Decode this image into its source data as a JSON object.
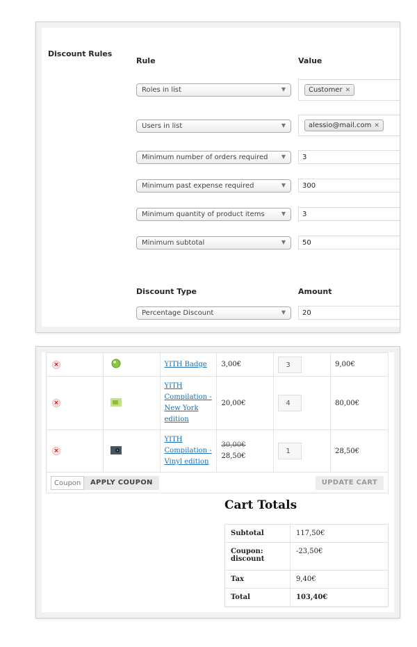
{
  "discount_rules": {
    "section_title": "Discount Rules",
    "rule_header": "Rule",
    "value_header": "Value",
    "rules": [
      {
        "rule": "Roles in list",
        "tag": "Customer"
      },
      {
        "rule": "Users in list",
        "tag": "alessio@mail.com"
      },
      {
        "rule": "Minimum number of orders required",
        "value": "3"
      },
      {
        "rule": "Minimum past expense required",
        "value": "300"
      },
      {
        "rule": "Minimum quantity of product items",
        "value": "3"
      },
      {
        "rule": "Minimum subtotal",
        "value": "50"
      }
    ],
    "type_header": "Discount Type",
    "amount_header": "Amount",
    "discount_type": "Percentage Discount",
    "amount": "20"
  },
  "cart": {
    "items": [
      {
        "name": "YITH Badge",
        "price": "3,00€",
        "qty": "3",
        "total": "9,00€"
      },
      {
        "name": "YITH Compilation - New York edition",
        "price": "20,00€",
        "qty": "4",
        "total": "80,00€"
      },
      {
        "name": "YITH Compilation - Vinyl edition",
        "old_price": "30,00€",
        "price": "28,50€",
        "qty": "1",
        "total": "28,50€"
      }
    ],
    "coupon_placeholder": "Coupon",
    "apply_coupon_label": "APPLY COUPON",
    "update_cart_label": "UPDATE CART"
  },
  "totals": {
    "title": "Cart Totals",
    "rows": [
      {
        "label": "Subtotal",
        "value": "117,50€"
      },
      {
        "label": "Coupon: discount",
        "value": "-23,50€"
      },
      {
        "label": "Tax",
        "value": "9,40€"
      },
      {
        "label": "Total",
        "value": "103,40€"
      }
    ]
  },
  "colors": {
    "link": "#1a6fb5",
    "remove": "#dd0000"
  }
}
